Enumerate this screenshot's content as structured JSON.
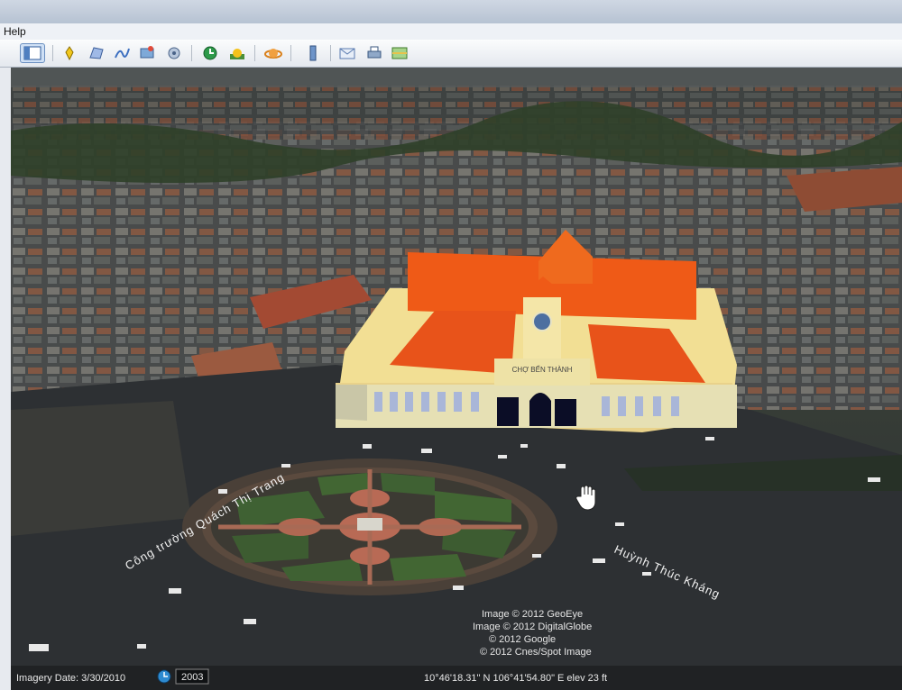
{
  "menu": {
    "help_label": "Help"
  },
  "toolbar": {
    "icons": [
      "sidebar-toggle-icon",
      "placemark-icon",
      "polygon-icon",
      "path-icon",
      "image-overlay-icon",
      "tour-icon",
      "historical-imagery-icon",
      "sunlight-icon",
      "planets-icon",
      "ruler-icon",
      "email-icon",
      "print-icon",
      "view-in-maps-icon"
    ]
  },
  "map": {
    "road_labels": {
      "left": "Công trường Quách Thị Trang",
      "right": "Huỳnh Thúc Kháng"
    },
    "attributions": [
      "Image © 2012 GeoEye",
      "Image © 2012 DigitalGlobe",
      "© 2012 Google",
      "© 2012 Cnes/Spot Image"
    ],
    "building_sign": "CHỢ BẾN THÀNH"
  },
  "status": {
    "imagery_date": "Imagery Date: 3/30/2010",
    "year_badge": "2003",
    "coordinates": "10°46'18.31\" N 106°41'54.80\" E elev   23 ft"
  },
  "colors": {
    "roof": "#ef5a17",
    "walls": "#f2df94",
    "grass": "#3d5a31",
    "plaza": "#b86a55"
  }
}
